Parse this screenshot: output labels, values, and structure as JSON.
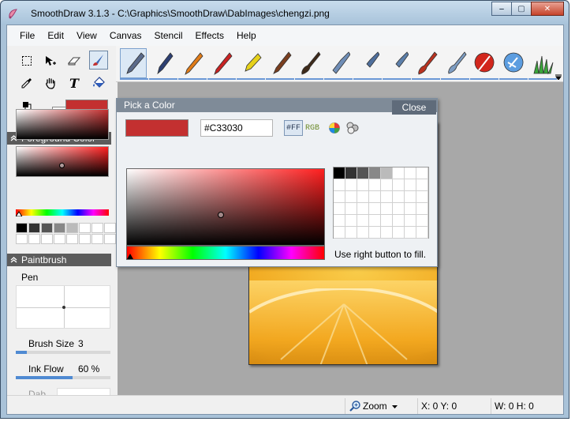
{
  "window": {
    "title": "SmoothDraw 3.1.3 - C:\\Graphics\\SmoothDraw\\DabImages\\chengzi.png",
    "controls": {
      "minimize": "‒",
      "maximize": "▢",
      "close": "✕"
    }
  },
  "menu": [
    "File",
    "Edit",
    "View",
    "Canvas",
    "Stencil",
    "Effects",
    "Help"
  ],
  "tools": [
    {
      "name": "select-icon"
    },
    {
      "name": "move-icon"
    },
    {
      "name": "eraser-icon"
    },
    {
      "name": "brush-tool-icon",
      "selected": true
    },
    {
      "name": "eyedropper-icon"
    },
    {
      "name": "hand-icon"
    },
    {
      "name": "text-icon",
      "glyph": "T"
    },
    {
      "name": "fill-bucket-icon"
    }
  ],
  "brushes": [
    {
      "name": "pen-brush-icon",
      "selected": true,
      "color": "#5a6a8a"
    },
    {
      "name": "ink-pen-brush-icon",
      "color": "#2c3f72"
    },
    {
      "name": "pencil-brush-icon",
      "color": "#e07b17"
    },
    {
      "name": "red-pencil-brush-icon",
      "color": "#c92222"
    },
    {
      "name": "highlighter-brush-icon",
      "color": "#e6d11b"
    },
    {
      "name": "marker-brush-icon",
      "color": "#7a3e1e"
    },
    {
      "name": "paintbrush-brush-icon",
      "color": "#3e2a1a"
    },
    {
      "name": "airbrush-brush-icon",
      "color": "#6f8db6"
    },
    {
      "name": "spray-brush-icon",
      "color": "#4f6f9c"
    },
    {
      "name": "scatter-brush-icon",
      "color": "#5c7faa"
    },
    {
      "name": "oil-brush-icon",
      "color": "#b8321f"
    },
    {
      "name": "watercolor-brush-icon",
      "color": "#7e9dc2"
    },
    {
      "name": "eraser-brush-icon",
      "color": "#d2261c"
    },
    {
      "name": "blur-brush-icon",
      "color": "#5c9de0"
    },
    {
      "name": "grass-brush-icon",
      "color": "#3aa63a"
    }
  ],
  "colors": {
    "foreground": "#C33030",
    "background": "#FFFFFF",
    "accent": "#4f8ad2"
  },
  "panels": {
    "foreground_header": "Foreground Color",
    "paintbrush_header": "Paintbrush",
    "brush_name": "Pen",
    "brush_size_label": "Brush Size",
    "brush_size_value": "3",
    "brush_size_fraction": 0.12,
    "ink_flow_label": "Ink Flow",
    "ink_flow_value": "60 %",
    "ink_flow_fraction": 0.6,
    "dab_label": "Dab"
  },
  "picker": {
    "title": "Pick a Color",
    "close_label": "Close",
    "hex_value": "#C33030",
    "hash_mode_label": "#FF",
    "rgb_mode_label": "RGB",
    "fill_hint": "Use right button to fill.",
    "palette_row1": [
      "#000000",
      "#333333",
      "#555555",
      "#888888",
      "#bbbbbb",
      "#ffffff",
      "#ffffff",
      "#ffffff"
    ]
  },
  "mini_palette": [
    "#000000",
    "#333333",
    "#555555",
    "#888888",
    "#bbbbbb",
    "#ffffff",
    "#ffffff",
    "#ffffff"
  ],
  "status": {
    "zoom_label": "Zoom",
    "coords": "X: 0 Y: 0",
    "size": "W: 0 H: 0"
  }
}
